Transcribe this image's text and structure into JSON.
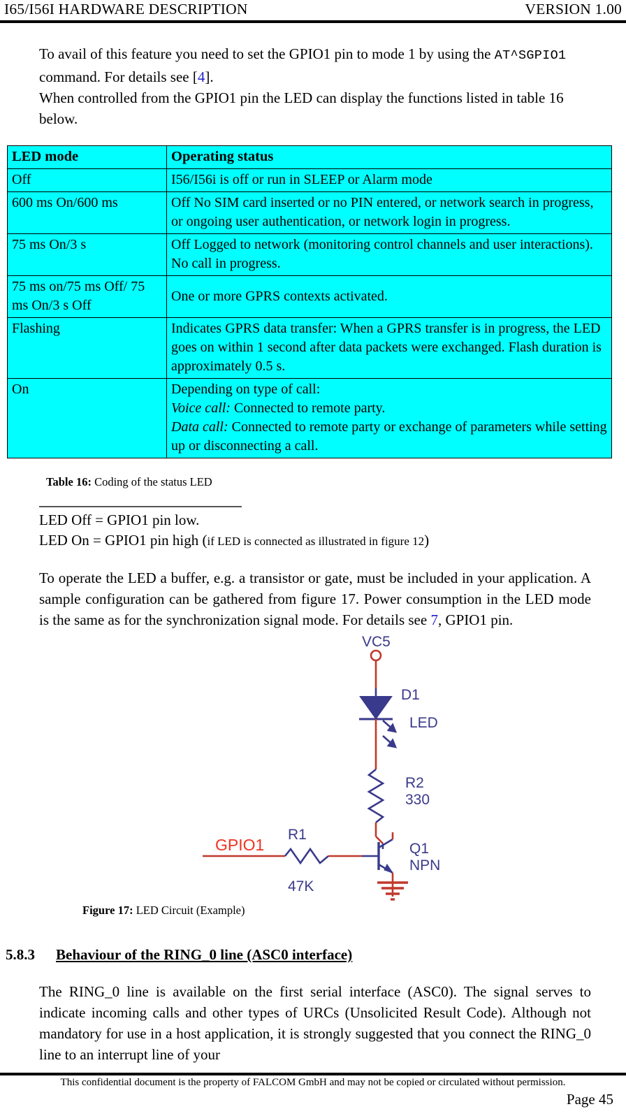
{
  "header": {
    "left": "I65/I56I HARDWARE DESCRIPTION",
    "right": "VERSION 1.00"
  },
  "intro": {
    "line1_a": "To avail of this feature you need to set the GPIO1 pin to mode 1 by using the ",
    "command": "AT^SGPIO1",
    "line1_b": " command. For details see [",
    "ref": "4",
    "line1_c": "].",
    "line2": "When controlled from the GPIO1 pin the LED can display the functions listed in table 16 below."
  },
  "table": {
    "headers": [
      "LED mode",
      "Operating status"
    ],
    "rows": [
      {
        "mode": "Off",
        "status": "I56/I56i is off or run in SLEEP or Alarm mode"
      },
      {
        "mode": "600 ms On/600 ms",
        "status": "Off No SIM card inserted or no PIN entered, or network search in progress, or ongoing user authentication, or network login in progress."
      },
      {
        "mode": "75 ms On/3 s",
        "status": "Off Logged to network (monitoring control channels and user interactions). No call in progress."
      },
      {
        "mode": "75 ms on/75 ms Off/ 75 ms On/3 s Off",
        "status": "One or more GPRS contexts activated."
      },
      {
        "mode": "Flashing",
        "status": "Indicates GPRS data transfer: When a GPRS transfer is in progress, the LED goes on within 1 second after data packets were exchanged. Flash duration is approximately 0.5 s."
      },
      {
        "mode": "On",
        "status_line1": "Depending on type of call:",
        "status_line2_em": "Voice call:",
        "status_line2": " Connected to remote party.",
        "status_line3_em": "Data call:",
        "status_line3": " Connected to remote party or exchange of parameters while setting up or disconnecting a call."
      }
    ],
    "caption_label": "Table 16:",
    "caption_text": " Coding of the status LED"
  },
  "led_note": {
    "line1": "LED Off = GPIO1 pin low.",
    "line2_a": "LED On = GPIO1 pin high (",
    "line2_small": "if LED is connected as illustrated in figure 12",
    "line2_b": ")"
  },
  "buffer_para": {
    "text_a": "To operate the LED a buffer, e.g. a transistor or gate, must be included in your application. A sample configuration can be gathered from figure 17. Power consumption in the LED mode is the same as for the synchronization signal mode. For details see ",
    "ref": "7",
    "text_b": ", GPIO1 pin."
  },
  "figure": {
    "labels": {
      "supply": "VC5",
      "diode_ref": "D1",
      "diode_type": "LED",
      "r2_ref": "R2",
      "r2_value": "330",
      "r1_ref": "R1",
      "r1_value": "47K",
      "q1_ref": "Q1",
      "q1_type": "NPN",
      "gpio": "GPIO1"
    },
    "colors": {
      "wire": "#c0392b",
      "symbol": "#3a3a8c",
      "gpio_label": "#ee3322"
    },
    "caption_label": "Figure 17:",
    "caption_text": " LED Circuit (Example)"
  },
  "section": {
    "number": "5.8.3",
    "title": "Behaviour of the RING_0 line (ASC0 interface)"
  },
  "last_para": {
    "text": "The RING_0 line is available on the first serial interface (ASC0). The signal serves to indicate incoming calls and other types of URCs (Unsolicited Result Code). Although not mandatory for use in a host application, it is strongly suggested that you connect the RING_0 line to an interrupt line of your"
  },
  "footer": {
    "text": "This confidential document is the property of FALCOM GmbH and may not be copied or circulated without permission.",
    "page": "Page 45"
  }
}
